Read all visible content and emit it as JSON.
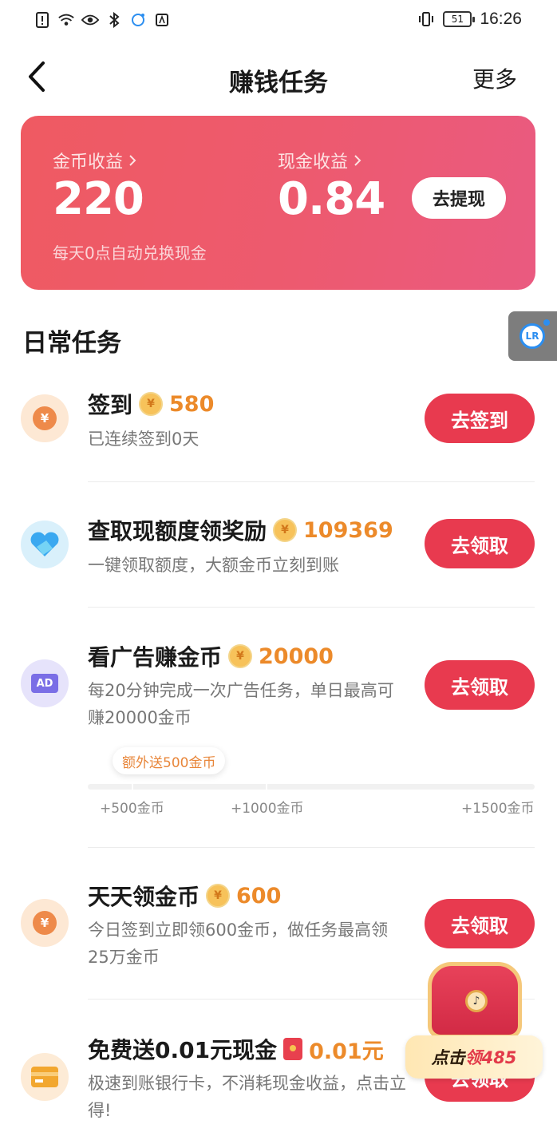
{
  "status_bar": {
    "time": "16:26",
    "battery": "51"
  },
  "nav": {
    "title": "赚钱任务",
    "more": "更多"
  },
  "earnings": {
    "coin_label": "金币收益",
    "coin_value": "220",
    "cash_label": "现金收益",
    "cash_value": "0.84",
    "withdraw_button": "去提现",
    "note": "每天0点自动兑换现金"
  },
  "section_title": "日常任务",
  "tasks": [
    {
      "title": "签到",
      "reward": "580",
      "desc": "已连续签到0天",
      "button": "去签到"
    },
    {
      "title": "查取现额度领奖励",
      "reward": "109369",
      "desc": "一键领取额度，大额金币立刻到账",
      "button": "去领取"
    },
    {
      "title": "看广告赚金币",
      "reward": "20000",
      "desc": "每20分钟完成一次广告任务，单日最高可赚20000金币",
      "button": "去领取"
    },
    {
      "title": "天天领金币",
      "reward": "600",
      "desc": "今日签到立即领600金币，做任务最高领25万金币",
      "button": "去领取"
    },
    {
      "title": "免费送0.01元现金",
      "reward": "0.01元",
      "desc": "极速到账银行卡，不消耗现金收益，点击立得!",
      "button": "去领取"
    }
  ],
  "ad_progress": {
    "bonus_tip": "额外送500金币",
    "milestones": [
      "+500金币",
      "+1000金币",
      "+1500金币"
    ]
  },
  "treasure": {
    "prefix": "点击",
    "highlight": "领485"
  },
  "colors": {
    "primary": "#e83a4f",
    "card_gradient_start": "#ef5a62",
    "card_gradient_end": "#ea5a80",
    "reward": "#ec8a2a"
  }
}
